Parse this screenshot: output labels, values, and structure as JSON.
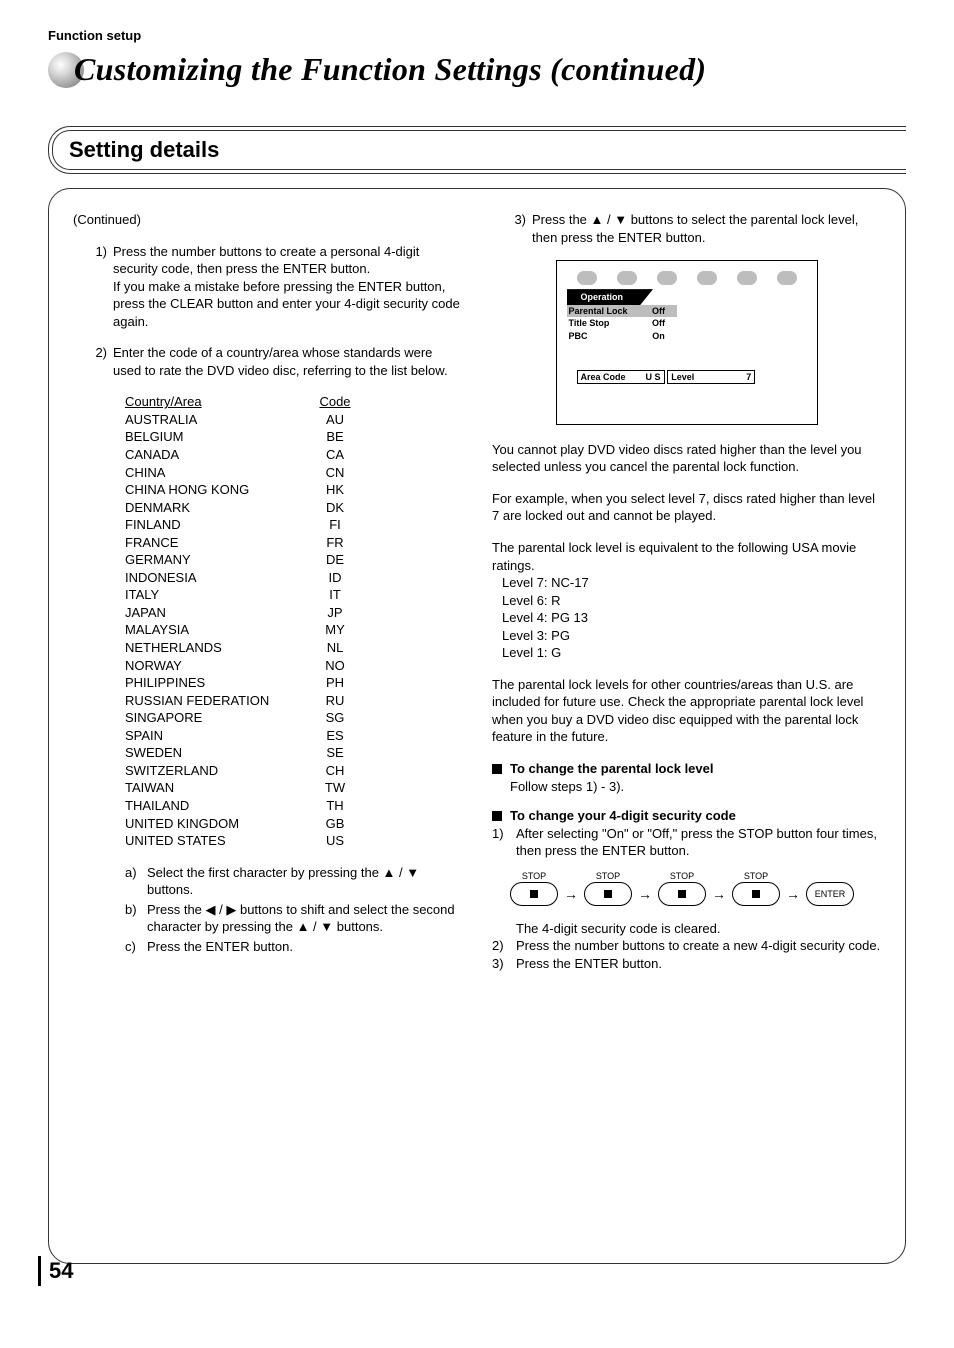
{
  "header": {
    "section": "Function setup"
  },
  "title": "Customizing the Function Settings (continued)",
  "setting_details": {
    "heading": "Setting details"
  },
  "continued": "(Continued)",
  "step1": {
    "num": "1)",
    "p1": "Press the number buttons to create a personal 4-digit security code, then press the ENTER button.",
    "p2": "If you make a mistake before pressing the ENTER button, press the CLEAR button and enter your 4-digit security code again."
  },
  "step2": {
    "num": "2)",
    "text": "Enter the code of a country/area whose standards were used to rate the DVD video disc, referring to the list below."
  },
  "country_table": {
    "head_country": "Country/Area",
    "head_code": "Code",
    "rows": [
      {
        "name": "AUSTRALIA",
        "code": "AU"
      },
      {
        "name": "BELGIUM",
        "code": "BE"
      },
      {
        "name": "CANADA",
        "code": "CA"
      },
      {
        "name": "CHINA",
        "code": "CN"
      },
      {
        "name": "CHINA HONG KONG",
        "code": "HK"
      },
      {
        "name": "DENMARK",
        "code": "DK"
      },
      {
        "name": "FINLAND",
        "code": "FI"
      },
      {
        "name": "FRANCE",
        "code": "FR"
      },
      {
        "name": "GERMANY",
        "code": "DE"
      },
      {
        "name": "INDONESIA",
        "code": "ID"
      },
      {
        "name": "ITALY",
        "code": "IT"
      },
      {
        "name": "JAPAN",
        "code": "JP"
      },
      {
        "name": "MALAYSIA",
        "code": "MY"
      },
      {
        "name": "NETHERLANDS",
        "code": "NL"
      },
      {
        "name": "NORWAY",
        "code": "NO"
      },
      {
        "name": "PHILIPPINES",
        "code": "PH"
      },
      {
        "name": "RUSSIAN FEDERATION",
        "code": "RU"
      },
      {
        "name": "SINGAPORE",
        "code": "SG"
      },
      {
        "name": "SPAIN",
        "code": "ES"
      },
      {
        "name": "SWEDEN",
        "code": "SE"
      },
      {
        "name": "SWITZERLAND",
        "code": "CH"
      },
      {
        "name": "TAIWAN",
        "code": "TW"
      },
      {
        "name": "THAILAND",
        "code": "TH"
      },
      {
        "name": "UNITED KINGDOM",
        "code": "GB"
      },
      {
        "name": "UNITED STATES",
        "code": "US"
      }
    ]
  },
  "sub_steps": {
    "a": {
      "n": "a)",
      "t": "Select the first character by pressing the ▲ / ▼ buttons."
    },
    "b": {
      "n": "b)",
      "t": "Press the ◀ / ▶ buttons to shift and select the second character by pressing the ▲ / ▼ buttons."
    },
    "c": {
      "n": "c)",
      "t": "Press the ENTER button."
    }
  },
  "step3": {
    "num": "3)",
    "text": "Press the ▲ / ▼ buttons to select the parental lock level, then press the ENTER button."
  },
  "screen": {
    "operation": "Operation",
    "rows": [
      {
        "name": "Parental Lock",
        "val": "Off",
        "hl": true
      },
      {
        "name": "Title Stop",
        "val": "Off",
        "hl": false
      },
      {
        "name": "PBC",
        "val": "On",
        "hl": false
      }
    ],
    "area_code_label": "Area Code",
    "area_code_val": "U S",
    "level_label": "Level",
    "level_val": "7"
  },
  "para_cannot": "You cannot play DVD video discs rated higher than the level you selected unless you cancel the parental lock function.",
  "para_example": "For example, when you select level 7, discs rated higher than level 7 are locked out and cannot be played.",
  "para_equiv": "The parental lock level is equivalent to the following USA movie ratings.",
  "levels": [
    "Level 7: NC-17",
    "Level 6: R",
    "Level 4: PG 13",
    "Level 3: PG",
    "Level 1: G"
  ],
  "para_other": "The parental lock levels for other countries/areas than U.S. are included for future use. Check the appropriate parental lock level when you buy a DVD video disc equipped with the parental lock feature in the future.",
  "change_level": {
    "head": "To change the parental lock level",
    "body": "Follow steps 1) - 3)."
  },
  "change_code": {
    "head": "To change your 4-digit security code",
    "s1n": "1)",
    "s1": "After selecting \"On\" or \"Off,\" press the STOP button four times, then press the ENTER button.",
    "stop_label": "STOP",
    "enter_label": "ENTER",
    "cleared": "The 4-digit security code is cleared.",
    "s2n": "2)",
    "s2": "Press the number buttons to create a new 4-digit security code.",
    "s3n": "3)",
    "s3": "Press the ENTER button."
  },
  "page_number": "54"
}
